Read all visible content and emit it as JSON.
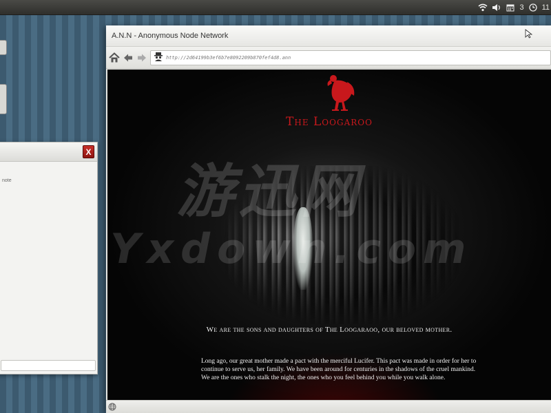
{
  "system_tray": {
    "workspace_count": "3",
    "clock_partial": "11"
  },
  "note_window": {
    "close_label": "X",
    "text": "note"
  },
  "browser": {
    "title": "A.N.N - Anonymous Node Network",
    "url": "http://2d64199b3ef6b7e8092209b870fef4d8.ann"
  },
  "page": {
    "brand_name": "The Loogaroo",
    "tagline": "We are the sons and daughters of The Loogaraoo, our beloved mother.",
    "story_lines": [
      "Long ago, our great mother made a pact with the merciful Lucifer. This pact was made in order for her to",
      "continue to serve us, her family.  We have been around for centuries in the shadows of the cruel mankind.",
      "We are the ones who stalk the night, the ones who you feel behind you while you walk alone."
    ],
    "watermark_cn": "游迅网",
    "watermark_en": "Yxdown.com",
    "brand_color": "#c8181c"
  }
}
